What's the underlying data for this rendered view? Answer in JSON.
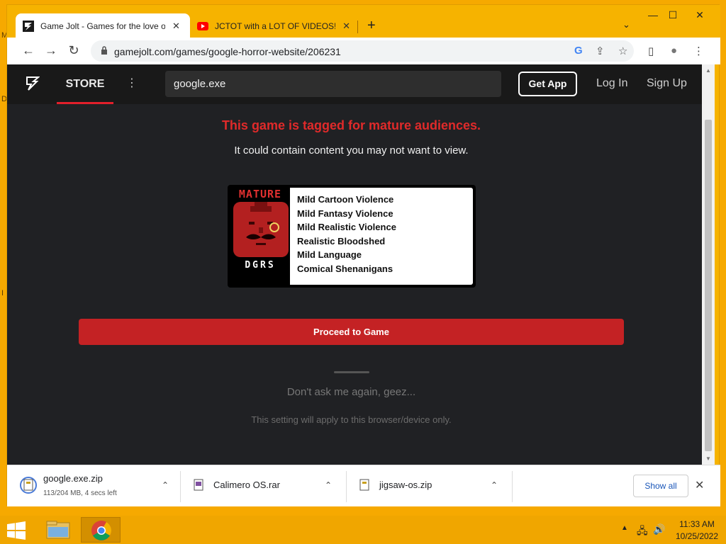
{
  "desktop": {
    "edge_glyphs": [
      "M",
      "D",
      "I"
    ]
  },
  "browser": {
    "tabs": [
      {
        "title": "Game Jolt - Games for the love o",
        "close": "✕",
        "favicon": "gamejolt-icon"
      },
      {
        "title": "JCTOT with a LOT OF VIDEOS!!!!!!",
        "close": "✕",
        "favicon": "youtube-icon"
      }
    ],
    "new_tab": "+",
    "tab_search": "⌄",
    "window_controls": {
      "minimize": "—",
      "maximize": "☐",
      "close": "✕"
    },
    "nav": {
      "back": "←",
      "forward": "→",
      "reload": "↻"
    },
    "url": "gamejolt.com/games/google-horror-website/206231",
    "omnibox_icons": {
      "google": "G",
      "share": "⇪",
      "star": "☆"
    },
    "toolbar_icons": {
      "side_panel": "▯",
      "profile": "●",
      "menu": "⋮"
    }
  },
  "gamejolt": {
    "nav": {
      "store": "STORE",
      "more": "⋮",
      "search_value": "google.exe",
      "get_app": "Get App",
      "log_in": "Log In",
      "sign_up": "Sign Up"
    },
    "warning_title": "This game is tagged for mature audiences.",
    "warning_sub": "It could contain content you may not want to view.",
    "rating": {
      "badge_top": "MATURE",
      "badge_bottom": "DGRS",
      "descriptors": [
        "Mild Cartoon Violence",
        "Mild Fantasy Violence",
        "Mild Realistic Violence",
        "Realistic Bloodshed",
        "Mild Language",
        "Comical Shenanigans"
      ]
    },
    "proceed": "Proceed to Game",
    "dont_ask": "Don't ask me again, geez...",
    "setting_note": "This setting will apply to this browser/device only."
  },
  "downloads": {
    "items": [
      {
        "name": "google.exe.zip",
        "status": "113/204 MB, 4 secs left"
      },
      {
        "name": "Calimero OS.rar",
        "status": ""
      },
      {
        "name": "jigsaw-os.zip",
        "status": ""
      }
    ],
    "caret": "⌃",
    "show_all": "Show all",
    "close": "✕"
  },
  "taskbar": {
    "tray_arrow": "▲",
    "clock_time": "11:33 AM",
    "clock_date": "10/25/2022",
    "tray_icons": {
      "network": "🖧",
      "volume": "🔊"
    }
  },
  "colors": {
    "accent_red": "#e02a2a",
    "proceed_red": "#c42224",
    "page_bg": "#202124",
    "desktop": "#f6a900"
  }
}
